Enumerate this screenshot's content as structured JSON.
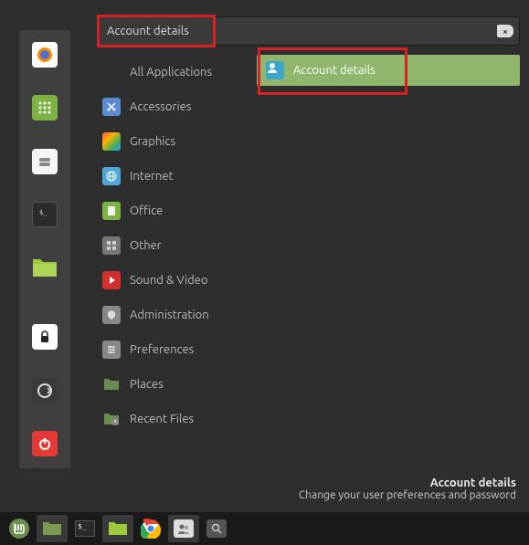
{
  "search": {
    "value": "Account details",
    "clear_glyph": "×"
  },
  "categories": [
    {
      "label": "All Applications",
      "icon": "all"
    },
    {
      "label": "Accessories",
      "icon": "scissors"
    },
    {
      "label": "Graphics",
      "icon": "graphics"
    },
    {
      "label": "Internet",
      "icon": "internet"
    },
    {
      "label": "Office",
      "icon": "office"
    },
    {
      "label": "Other",
      "icon": "other"
    },
    {
      "label": "Sound & Video",
      "icon": "media"
    },
    {
      "label": "Administration",
      "icon": "admin"
    },
    {
      "label": "Preferences",
      "icon": "prefs"
    },
    {
      "label": "Places",
      "icon": "folder"
    },
    {
      "label": "Recent Files",
      "icon": "recent"
    }
  ],
  "results": [
    {
      "label": "Account details",
      "icon": "account"
    }
  ],
  "footer": {
    "title": "Account details",
    "subtitle": "Change your user preferences and password"
  },
  "favorites": [
    {
      "name": "firefox"
    },
    {
      "name": "apps-grid"
    },
    {
      "name": "software-manager"
    },
    {
      "name": "terminal"
    },
    {
      "name": "files"
    },
    {
      "name": "lock"
    },
    {
      "name": "logout"
    },
    {
      "name": "power"
    }
  ],
  "taskbar": [
    {
      "name": "menu"
    },
    {
      "name": "files"
    },
    {
      "name": "terminal"
    },
    {
      "name": "files2"
    },
    {
      "name": "chrome"
    },
    {
      "name": "contacts"
    },
    {
      "name": "search"
    }
  ],
  "colors": {
    "accent": "#8fb66b",
    "highlight": "#d62222"
  }
}
